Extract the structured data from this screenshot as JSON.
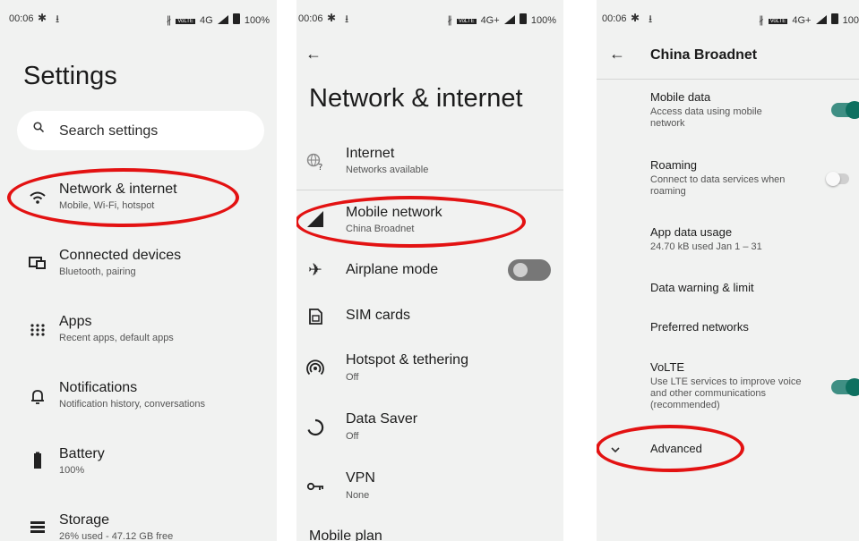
{
  "status": {
    "time": "00:06",
    "signal_tag": "VoLTE",
    "net1": "4G",
    "net2": "4G+",
    "battery": "100%",
    "battery_cut": "100"
  },
  "panel1": {
    "title": "Settings",
    "search_placeholder": "Search settings",
    "items": [
      {
        "title": "Network & internet",
        "subtitle": "Mobile, Wi-Fi, hotspot"
      },
      {
        "title": "Connected devices",
        "subtitle": "Bluetooth, pairing"
      },
      {
        "title": "Apps",
        "subtitle": "Recent apps, default apps"
      },
      {
        "title": "Notifications",
        "subtitle": "Notification history, conversations"
      },
      {
        "title": "Battery",
        "subtitle": "100%"
      },
      {
        "title": "Storage",
        "subtitle": "26% used - 47.12 GB free"
      }
    ]
  },
  "panel2": {
    "back": "←",
    "title": "Network & internet",
    "items": [
      {
        "title": "Internet",
        "subtitle": "Networks available"
      },
      {
        "title": "Mobile network",
        "subtitle": "China Broadnet"
      },
      {
        "title": "Airplane mode",
        "subtitle": ""
      },
      {
        "title": "SIM cards",
        "subtitle": ""
      },
      {
        "title": "Hotspot & tethering",
        "subtitle": "Off"
      },
      {
        "title": "Data Saver",
        "subtitle": "Off"
      },
      {
        "title": "VPN",
        "subtitle": "None"
      },
      {
        "title": "Mobile plan",
        "subtitle": ""
      }
    ],
    "airplane_on": false
  },
  "panel3": {
    "back": "←",
    "title": "China Broadnet",
    "items": [
      {
        "title": "Mobile data",
        "subtitle": "Access data using mobile network",
        "toggle": true
      },
      {
        "title": "Roaming",
        "subtitle": "Connect to data services when roaming",
        "toggle": false
      },
      {
        "title": "App data usage",
        "subtitle": "24.70 kB used Jan 1 – 31"
      },
      {
        "title": "Data warning & limit",
        "subtitle": ""
      },
      {
        "title": "Preferred networks",
        "subtitle": ""
      },
      {
        "title": "VoLTE",
        "subtitle": "Use LTE services to improve voice and other communications (recommended)",
        "toggle": true
      },
      {
        "title": "Advanced",
        "subtitle": ""
      }
    ]
  },
  "colors": {
    "accent_toggle": "#0e7060",
    "highlight": "#e31212",
    "background": "#f1f2f1"
  },
  "icons": [
    "gear-icon",
    "download-icon",
    "bluetooth-icon",
    "signal-icon",
    "battery-icon",
    "search-icon",
    "wifi-icon",
    "devices-icon",
    "apps-grid-icon",
    "bell-icon",
    "battery-full-icon",
    "storage-icon",
    "globe-icon",
    "cell-signal-icon",
    "airplane-icon",
    "sim-card-icon",
    "hotspot-icon",
    "data-saver-icon",
    "vpn-key-icon",
    "chevron-down-icon",
    "back-arrow-icon"
  ]
}
